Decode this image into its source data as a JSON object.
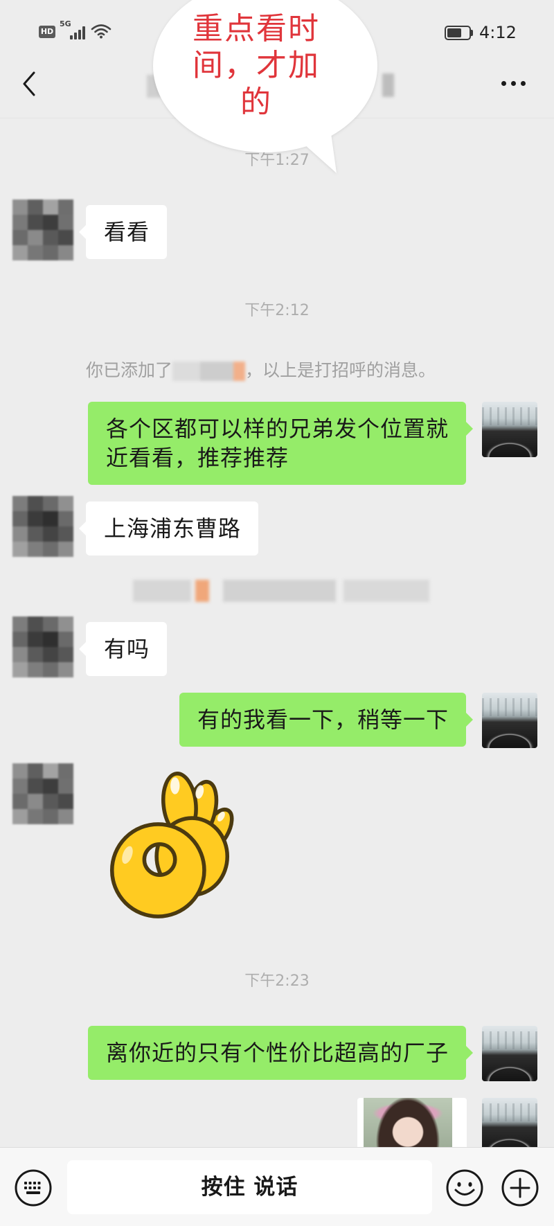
{
  "status_bar": {
    "hd_badge": "HD",
    "network_type": "5G",
    "time": "4:12",
    "battery_level": 0.72,
    "icons": {
      "signal": "signal-bars-icon",
      "wifi": "wifi-icon",
      "battery": "battery-icon"
    }
  },
  "nav": {
    "back_icon": "chevron-left-icon",
    "more_icon": "more-dots-icon"
  },
  "annotation": {
    "lines": [
      "重点看时",
      "间，才加",
      "的"
    ]
  },
  "chat": {
    "timestamps": [
      "下午1:27",
      "下午2:12",
      "下午2:23"
    ],
    "system_notice": {
      "prefix": "你已添加了",
      "suffix": "，以上是打招呼的消息。"
    },
    "messages": [
      {
        "text": "看看"
      },
      {
        "lines": [
          "各个区都可以样的兄弟发个位置就",
          "近看看，推荐推荐"
        ]
      },
      {
        "text": "上海浦东曹路"
      },
      {
        "text": "有吗"
      },
      {
        "text": "有的我看一下，稍等一下"
      },
      {
        "sticker_icon": "ok-hand-sticker-icon"
      },
      {
        "text": "离你近的只有个性价比超高的厂子"
      },
      {
        "image_icon": "photo-thumbnail-icon"
      }
    ]
  },
  "input_bar": {
    "hold_to_talk_label": "按住 说话",
    "icons": {
      "keyboard": "keyboard-icon",
      "emoji": "emoji-icon",
      "more": "plus-circle-icon"
    }
  },
  "colors": {
    "chat_background": "#EDEDED",
    "incoming_bubble": "#FFFFFF",
    "outgoing_bubble": "#95EC69",
    "annotation_text": "#E0353B",
    "timestamp_text": "#ADADAD",
    "input_bar_background": "#F7F7F7"
  }
}
